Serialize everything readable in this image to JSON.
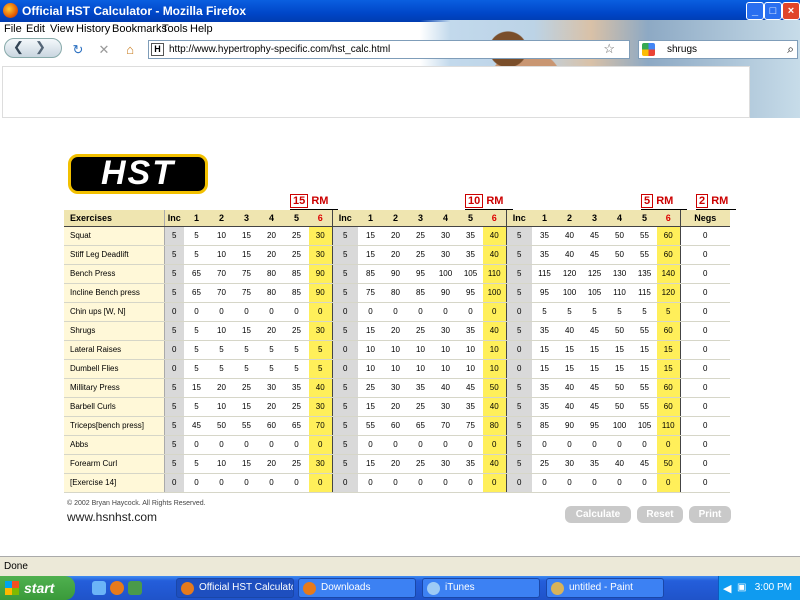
{
  "window": {
    "title": "Official HST Calculator - Mozilla Firefox"
  },
  "menu": [
    "File",
    "Edit",
    "View",
    "History",
    "Bookmarks",
    "Tools",
    "Help"
  ],
  "url": "http://www.hypertrophy-specific.com/hst_calc.html",
  "search_query": "shrugs",
  "logo_text": "HST",
  "rm_labels": {
    "a": "15",
    "b": "10",
    "c": "5",
    "d": "2",
    "suffix": "RM"
  },
  "headers": [
    "Exercises",
    "Inc",
    "1",
    "2",
    "3",
    "4",
    "5",
    "6",
    "Inc",
    "1",
    "2",
    "3",
    "4",
    "5",
    "6",
    "Inc",
    "1",
    "2",
    "3",
    "4",
    "5",
    "6",
    "Negs"
  ],
  "rows": [
    {
      "name": "Squat",
      "v": [
        "5",
        "5",
        "10",
        "15",
        "20",
        "25",
        "30",
        "5",
        "15",
        "20",
        "25",
        "30",
        "35",
        "40",
        "5",
        "35",
        "40",
        "45",
        "50",
        "55",
        "60",
        "0"
      ]
    },
    {
      "name": "Stiff Leg Deadlift",
      "v": [
        "5",
        "5",
        "10",
        "15",
        "20",
        "25",
        "30",
        "5",
        "15",
        "20",
        "25",
        "30",
        "35",
        "40",
        "5",
        "35",
        "40",
        "45",
        "50",
        "55",
        "60",
        "0"
      ]
    },
    {
      "name": "Bench Press",
      "v": [
        "5",
        "65",
        "70",
        "75",
        "80",
        "85",
        "90",
        "5",
        "85",
        "90",
        "95",
        "100",
        "105",
        "110",
        "5",
        "115",
        "120",
        "125",
        "130",
        "135",
        "140",
        "0"
      ]
    },
    {
      "name": "Incline Bench press",
      "v": [
        "5",
        "65",
        "70",
        "75",
        "80",
        "85",
        "90",
        "5",
        "75",
        "80",
        "85",
        "90",
        "95",
        "100",
        "5",
        "95",
        "100",
        "105",
        "110",
        "115",
        "120",
        "0"
      ]
    },
    {
      "name": "Chin ups [W, N]",
      "v": [
        "0",
        "0",
        "0",
        "0",
        "0",
        "0",
        "0",
        "0",
        "0",
        "0",
        "0",
        "0",
        "0",
        "0",
        "0",
        "5",
        "5",
        "5",
        "5",
        "5",
        "5",
        "0"
      ]
    },
    {
      "name": "Shrugs",
      "v": [
        "5",
        "5",
        "10",
        "15",
        "20",
        "25",
        "30",
        "5",
        "15",
        "20",
        "25",
        "30",
        "35",
        "40",
        "5",
        "35",
        "40",
        "45",
        "50",
        "55",
        "60",
        "0"
      ]
    },
    {
      "name": "Lateral Raises",
      "v": [
        "0",
        "5",
        "5",
        "5",
        "5",
        "5",
        "5",
        "0",
        "10",
        "10",
        "10",
        "10",
        "10",
        "10",
        "0",
        "15",
        "15",
        "15",
        "15",
        "15",
        "15",
        "0"
      ]
    },
    {
      "name": "Dumbell Flies",
      "v": [
        "0",
        "5",
        "5",
        "5",
        "5",
        "5",
        "5",
        "0",
        "10",
        "10",
        "10",
        "10",
        "10",
        "10",
        "0",
        "15",
        "15",
        "15",
        "15",
        "15",
        "15",
        "0"
      ]
    },
    {
      "name": "Millitary Press",
      "v": [
        "5",
        "15",
        "20",
        "25",
        "30",
        "35",
        "40",
        "5",
        "25",
        "30",
        "35",
        "40",
        "45",
        "50",
        "5",
        "35",
        "40",
        "45",
        "50",
        "55",
        "60",
        "0"
      ]
    },
    {
      "name": "Barbell Curls",
      "v": [
        "5",
        "5",
        "10",
        "15",
        "20",
        "25",
        "30",
        "5",
        "15",
        "20",
        "25",
        "30",
        "35",
        "40",
        "5",
        "35",
        "40",
        "45",
        "50",
        "55",
        "60",
        "0"
      ]
    },
    {
      "name": "Triceps[bench press]",
      "v": [
        "5",
        "45",
        "50",
        "55",
        "60",
        "65",
        "70",
        "5",
        "55",
        "60",
        "65",
        "70",
        "75",
        "80",
        "5",
        "85",
        "90",
        "95",
        "100",
        "105",
        "110",
        "0"
      ]
    },
    {
      "name": "Abbs",
      "v": [
        "5",
        "0",
        "0",
        "0",
        "0",
        "0",
        "0",
        "5",
        "0",
        "0",
        "0",
        "0",
        "0",
        "0",
        "5",
        "0",
        "0",
        "0",
        "0",
        "0",
        "0",
        "0"
      ]
    },
    {
      "name": "Forearm Curl",
      "v": [
        "5",
        "5",
        "10",
        "15",
        "20",
        "25",
        "30",
        "5",
        "15",
        "20",
        "25",
        "30",
        "35",
        "40",
        "5",
        "25",
        "30",
        "35",
        "40",
        "45",
        "50",
        "0"
      ]
    },
    {
      "name": "[Exercise 14]",
      "v": [
        "0",
        "0",
        "0",
        "0",
        "0",
        "0",
        "0",
        "0",
        "0",
        "0",
        "0",
        "0",
        "0",
        "0",
        "0",
        "0",
        "0",
        "0",
        "0",
        "0",
        "0",
        "0"
      ]
    }
  ],
  "copyright": "© 2002 Bryan Haycock.  All Rights Reserved.",
  "site": "www.hsnhst.com",
  "buttons": {
    "calculate": "Calculate",
    "reset": "Reset",
    "print": "Print"
  },
  "status": "Done",
  "taskbar": {
    "start": "start",
    "tasks": [
      "Official HST Calculato...",
      "Downloads",
      "iTunes",
      "untitled - Paint"
    ],
    "clock": "3:00 PM"
  },
  "colors": {
    "title_bar": "#0046c8",
    "header_bg": "#efe5b0",
    "six_col": "#ffef5a",
    "inc_col": "#d9d9d9",
    "rm_red": "#cc0000"
  }
}
